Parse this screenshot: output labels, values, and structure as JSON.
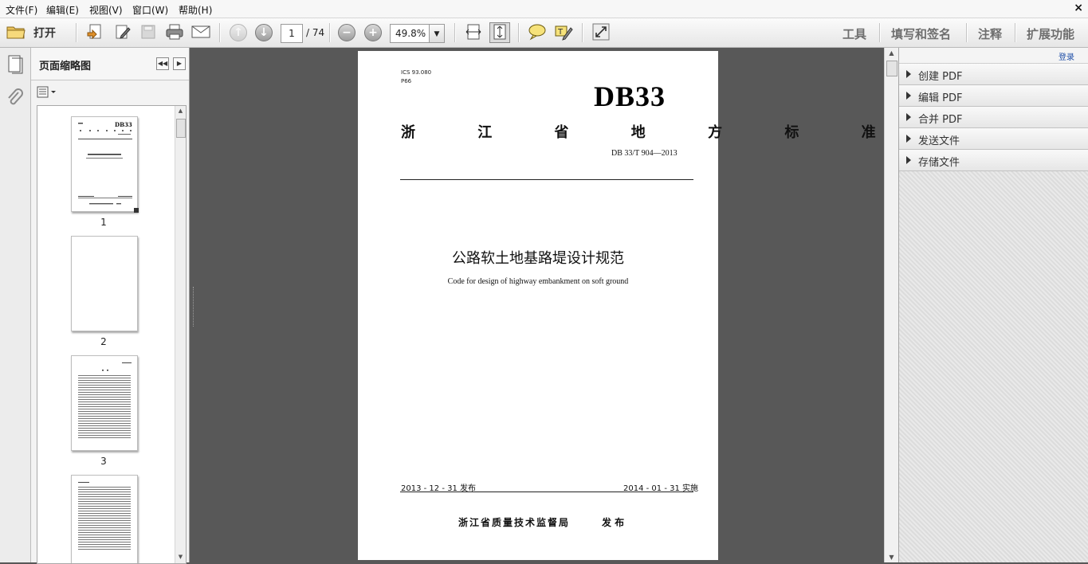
{
  "menu": {
    "items": [
      "文件(F)",
      "编辑(E)",
      "视图(V)",
      "窗口(W)",
      "帮助(H)"
    ],
    "close_glyph": "×"
  },
  "toolbar": {
    "open_label": "打开",
    "page_current": "1",
    "page_total": "/ 74",
    "zoom": "49.8%",
    "right_links": [
      "工具",
      "填写和签名",
      "注释",
      "扩展功能"
    ],
    "icons": [
      "folder-icon",
      "create-icon",
      "edit-icon",
      "save-icon",
      "print-icon",
      "mail-icon",
      "prev-page-icon",
      "next-page-icon",
      "zoom-out-icon",
      "zoom-in-icon",
      "fit-width-icon",
      "fit-page-icon",
      "comment-icon",
      "highlight-icon",
      "expand-icon"
    ]
  },
  "left_panel": {
    "title": "页面缩略图",
    "thumb_numbers": [
      "1",
      "2",
      "3"
    ]
  },
  "document": {
    "ics": "ICS 93.080",
    "p": "P66",
    "db_code": "DB33",
    "province_std": "浙 江 省 地 方 标 准",
    "std_number": "DB 33/T 904—2013",
    "title_cn": "公路软土地基路堤设计规范",
    "title_en": "Code for design of highway embankment on soft ground",
    "publish_date": "2013 - 12 - 31 发布",
    "implement_date": "2014 - 01 - 31 实施",
    "issuer": "浙江省质量技术监督局",
    "issue_word": "发 布"
  },
  "right_panel": {
    "login": "登录",
    "items": [
      "创建 PDF",
      "编辑 PDF",
      "合并 PDF",
      "发送文件",
      "存储文件"
    ]
  }
}
